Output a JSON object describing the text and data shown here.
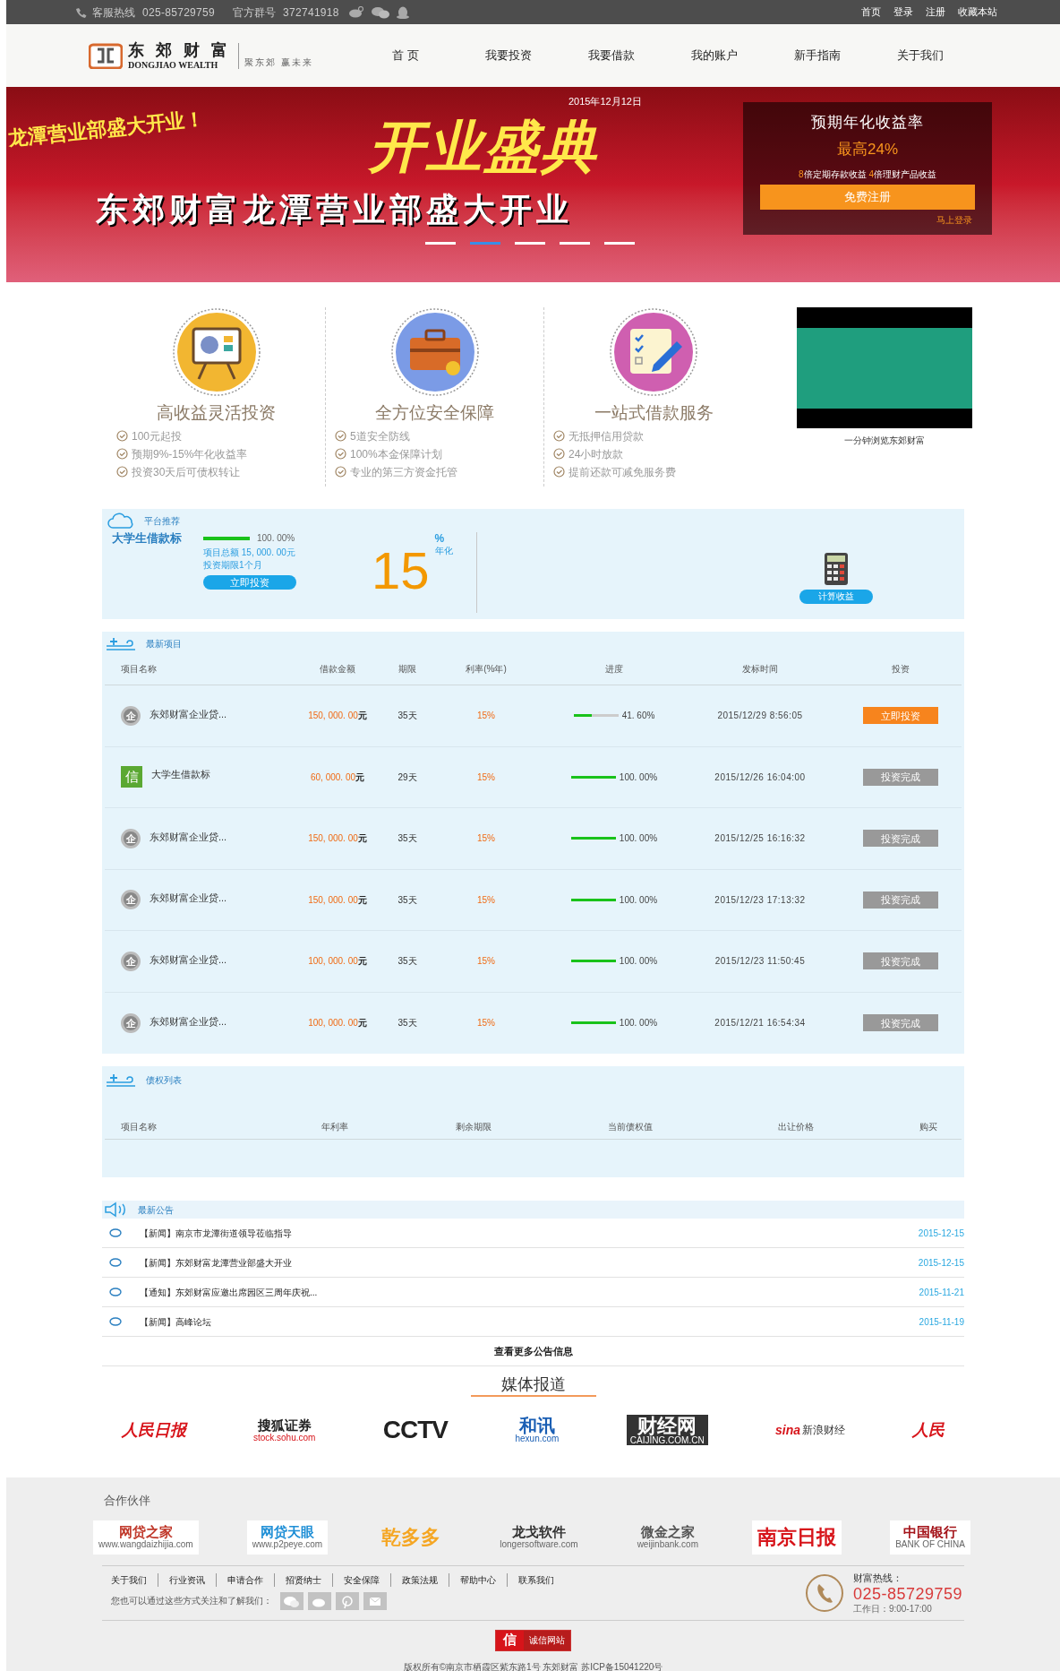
{
  "top_bar": {
    "hotline_label": "客服热线",
    "hotline": "025-85729759",
    "group_label": "官方群号",
    "group": "372741918",
    "links": [
      "首页",
      "登录",
      "注册",
      "收藏本站"
    ]
  },
  "header": {
    "logo_name": "东 郊 财 富",
    "logo_en": "DONGJIAO WEALTH",
    "slogan": "聚东郊 赢未来",
    "nav": [
      "首 页",
      "我要投资",
      "我要借款",
      "我的账户",
      "新手指南",
      "关于我们"
    ]
  },
  "banner": {
    "date": "2015年12月12日",
    "title": "开业盛典",
    "tagline": "龙潭营业部盛大开业！",
    "headline": "东郊财富龙潭营业部盛大开业",
    "panel": {
      "title": "预期年化收益率",
      "rate": "最高24%",
      "note": "**8**倍定期存款收益 **4**倍理财产品收益",
      "register": "免费注册",
      "login": "马上登录"
    },
    "dots": [
      {
        "selected": false
      },
      {
        "selected": true
      },
      {
        "selected": false
      },
      {
        "selected": false
      },
      {
        "selected": false
      }
    ]
  },
  "features": [
    {
      "kind": "easel",
      "title": "高收益灵活投资",
      "items": [
        "100元起投",
        "预期9%-15%年化收益率",
        "投资30天后可债权转让"
      ]
    },
    {
      "kind": "briefcase",
      "title": "全方位安全保障",
      "items": [
        "5道安全防线",
        "100%本金保障计划",
        "专业的第三方资金托管"
      ]
    },
    {
      "kind": "checklist",
      "title": "一站式借款服务",
      "items": [
        "无抵押信用贷款",
        "24小时放款",
        "提前还款可减免服务费"
      ]
    }
  ],
  "video": {
    "caption": "一分钟浏览东郊财富"
  },
  "recommend": {
    "label": "平台推荐",
    "name": "大学生借款标",
    "level": 1,
    "progress": "100. 00%",
    "total": "项目总额 15, 000. 00元",
    "term": "投资期限1个月",
    "invest": "立即投资",
    "rate": "15",
    "percent": "%",
    "rate_label": "年化",
    "calc": "计算收益"
  },
  "projects": {
    "label": "最新项目",
    "columns": [
      "项目名称",
      "借款金额",
      "期限",
      "利率(%年)",
      "进度",
      "发标时间",
      "投资"
    ],
    "rows": [
      {
        "kind": "enterprise",
        "badge": "企",
        "name": "东郊财富企业贷...",
        "amount": "150, 000. 00**元**",
        "term": "35天",
        "rate": "15%",
        "level": 0.416,
        "progress": "41. 60%",
        "time": "2015/12/29 8:56:05",
        "button": "立即投资",
        "disabled": false
      },
      {
        "kind": "credit",
        "badge": "信",
        "name": "大学生借款标",
        "amount": "60, 000. 00**元**",
        "term": "29天",
        "rate": "15%",
        "level": 1,
        "progress": "100. 00%",
        "time": "2015/12/26 16:04:00",
        "button": "投资完成",
        "disabled": true
      },
      {
        "kind": "enterprise",
        "badge": "企",
        "name": "东郊财富企业贷...",
        "amount": "150, 000. 00**元**",
        "term": "35天",
        "rate": "15%",
        "level": 1,
        "progress": "100. 00%",
        "time": "2015/12/25 16:16:32",
        "button": "投资完成",
        "disabled": true
      },
      {
        "kind": "enterprise",
        "badge": "企",
        "name": "东郊财富企业贷...",
        "amount": "150, 000. 00**元**",
        "term": "35天",
        "rate": "15%",
        "level": 1,
        "progress": "100. 00%",
        "time": "2015/12/23 17:13:32",
        "button": "投资完成",
        "disabled": true
      },
      {
        "kind": "enterprise",
        "badge": "企",
        "name": "东郊财富企业贷...",
        "amount": "100, 000. 00**元**",
        "term": "35天",
        "rate": "15%",
        "level": 1,
        "progress": "100. 00%",
        "time": "2015/12/23 11:50:45",
        "button": "投资完成",
        "disabled": true
      },
      {
        "kind": "enterprise",
        "badge": "企",
        "name": "东郊财富企业贷...",
        "amount": "100, 000. 00**元**",
        "term": "35天",
        "rate": "15%",
        "level": 1,
        "progress": "100. 00%",
        "time": "2015/12/21 16:54:34",
        "button": "投资完成",
        "disabled": true
      }
    ]
  },
  "bonds": {
    "label": "债权列表",
    "columns": [
      "项目名称",
      "年利率",
      "剩余期限",
      "当前债权值",
      "出让价格",
      "购买"
    ]
  },
  "notices": {
    "label": "最新公告",
    "items": [
      {
        "text": "【新闻】南京市龙潭街道领导莅临指导",
        "date": "2015-12-15"
      },
      {
        "text": "【新闻】东郊财富龙潭营业部盛大开业",
        "date": "2015-12-15"
      },
      {
        "text": "【通知】东郊财富应邀出席园区三周年庆祝...",
        "date": "2015-11-21"
      },
      {
        "text": "【新闻】高峰论坛",
        "date": "2015-11-19"
      }
    ],
    "more": "查看更多公告信息"
  },
  "media": {
    "title": "媒体报道",
    "logos": [
      {
        "kind": "renmin",
        "text": "人民日报"
      },
      {
        "kind": "sohu",
        "text": "搜狐证券",
        "sub": "stock.sohu.com"
      },
      {
        "kind": "cctv",
        "text": "CCTV"
      },
      {
        "kind": "hexun",
        "text": "和讯",
        "sub": "hexun.com"
      },
      {
        "kind": "caijing",
        "text": "财经网",
        "sub": "CAIJING.COM.CN"
      },
      {
        "kind": "sina",
        "text": "新浪财经",
        "sub": "sina"
      },
      {
        "kind": "renmin",
        "text": "人民"
      }
    ]
  },
  "partners": {
    "title": "合作伙伴",
    "logos": [
      {
        "kind": "wangdai",
        "text": "网贷之家",
        "sub": "www.wangdaizhijia.com"
      },
      {
        "kind": "p2peye",
        "text": "网贷天眼",
        "sub": "www.p2peye.com"
      },
      {
        "kind": "qian",
        "text": "乾多多"
      },
      {
        "kind": "longer",
        "text": "龙戈软件",
        "sub": "longersoftware.com"
      },
      {
        "kind": "weijin",
        "text": "微金之家",
        "sub": "weijinbank.com"
      },
      {
        "kind": "njdaily",
        "text": "南京日报"
      },
      {
        "kind": "boc",
        "text": "中国银行",
        "sub": "BANK OF CHINA"
      }
    ]
  },
  "footer": {
    "links": [
      "关于我们",
      "行业资讯",
      "申请合作",
      "招贤纳士",
      "安全保障",
      "政策法规",
      "帮助中心",
      "联系我们"
    ],
    "follow": "您也可以通过这些方式关注和了解我们：",
    "hotline_label": "财富热线：",
    "hotline": "025-85729759",
    "hours": "工作日：9:00-17:00",
    "badge_icon": "信",
    "badge": "诚信网站",
    "copyright": "版权所有©南京市栖霞区紫东路1号 东郊财富 苏ICP备15041220号"
  }
}
